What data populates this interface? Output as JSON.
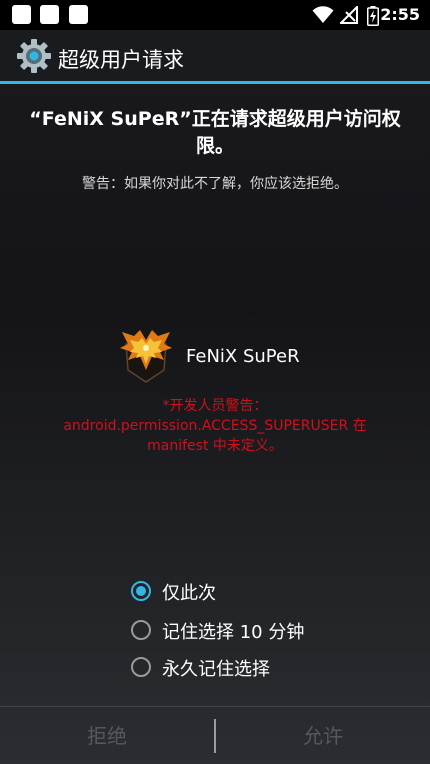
{
  "status_bar": {
    "time": "2:55",
    "notification_icons": [
      "notification-icon",
      "notification-icon",
      "notification-icon"
    ],
    "icons": [
      "wifi-icon",
      "no-signal-icon",
      "battery-charging-icon"
    ]
  },
  "title_bar": {
    "icon": "settings-gear-icon",
    "title": "超级用户请求",
    "accent_color": "#33b5e5"
  },
  "request": {
    "headline": "“FeNiX SuPeR”正在请求超级用户访问权限。",
    "warning": "警告：如果你对此不了解，你应该选拒绝。"
  },
  "app": {
    "logo": "phoenix-logo-icon",
    "name": "FeNiX SuPeR"
  },
  "developer_warning": {
    "lines": [
      "*开发人员警告：",
      "android.permission.ACCESS_SUPERUSER 在",
      "manifest 中未定义。"
    ],
    "color": "#d0101c"
  },
  "options": [
    {
      "label": "仅此次",
      "selected": true
    },
    {
      "label": "记住选择 10 分钟",
      "selected": false
    },
    {
      "label": "永久记住选择",
      "selected": false
    }
  ],
  "buttons": {
    "deny": "拒绝",
    "allow": "允许"
  }
}
